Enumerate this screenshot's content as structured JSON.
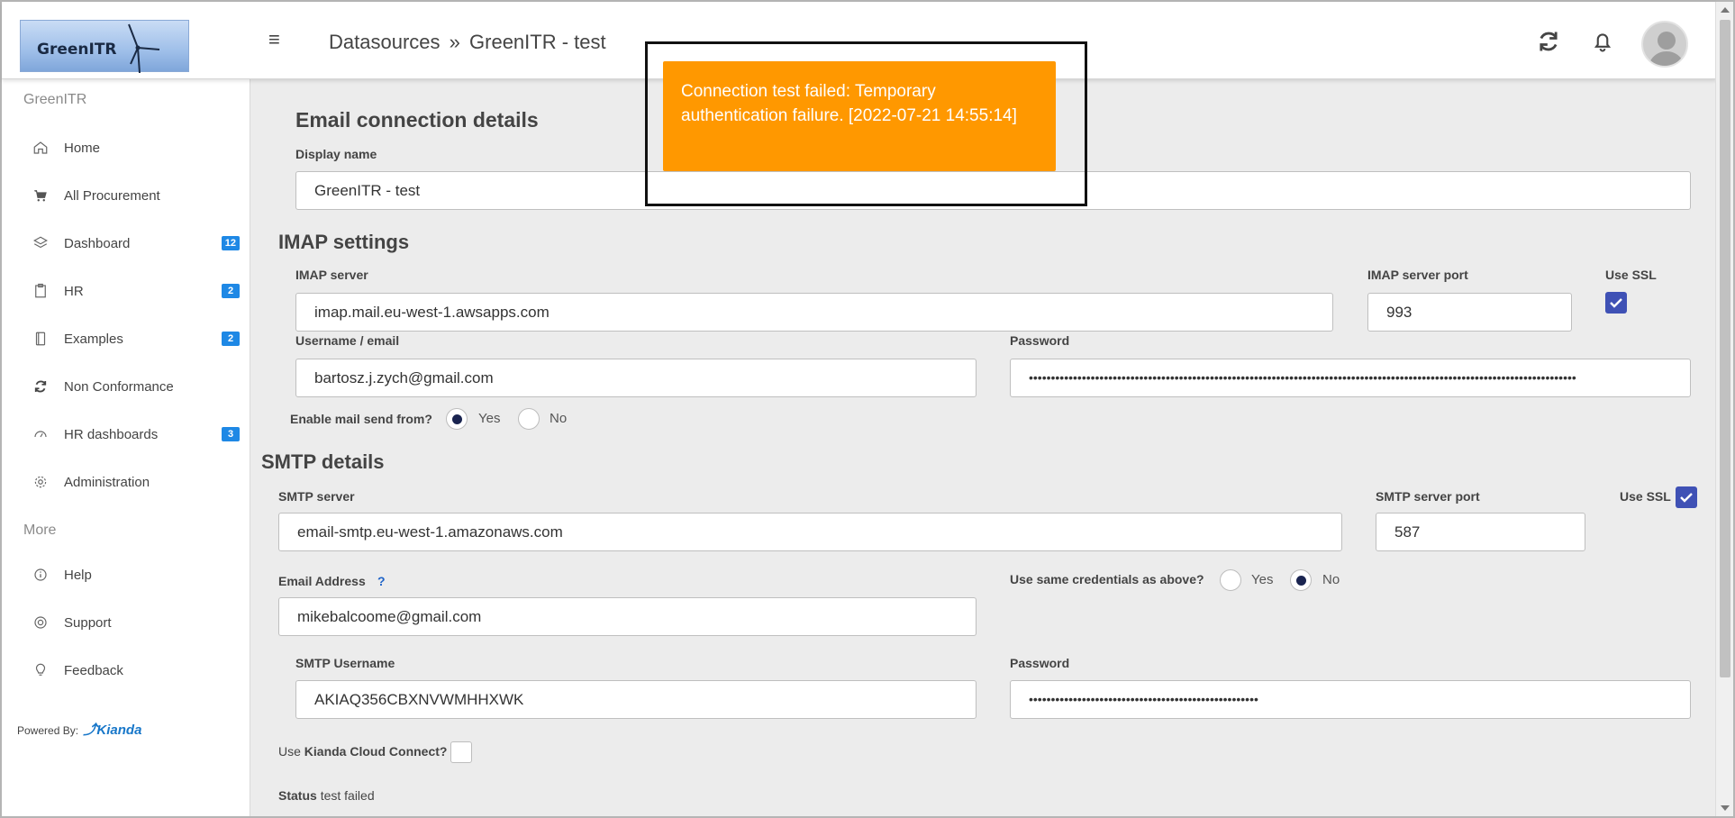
{
  "header": {
    "logo_text": "GreenITR",
    "breadcrumb_parent": "Datasources",
    "breadcrumb_sep": "»",
    "breadcrumb_current": "GreenITR - test"
  },
  "toast": {
    "message": "Connection test failed: Temporary authentication failure. [2022-07-21 14:55:14]"
  },
  "sidebar": {
    "app_heading": "GreenITR",
    "items": [
      {
        "label": "Home",
        "icon": "home-icon",
        "badge": ""
      },
      {
        "label": "All Procurement",
        "icon": "cart-icon",
        "badge": ""
      },
      {
        "label": "Dashboard",
        "icon": "layers-icon",
        "badge": "12"
      },
      {
        "label": "HR",
        "icon": "clipboard-icon",
        "badge": "2"
      },
      {
        "label": "Examples",
        "icon": "book-icon",
        "badge": "2"
      },
      {
        "label": "Non Conformance",
        "icon": "refresh-icon",
        "badge": ""
      },
      {
        "label": "HR dashboards",
        "icon": "gauge-icon",
        "badge": "3"
      },
      {
        "label": "Administration",
        "icon": "gear-icon",
        "badge": ""
      }
    ],
    "more_heading": "More",
    "more_items": [
      {
        "label": "Help",
        "icon": "info-icon"
      },
      {
        "label": "Support",
        "icon": "lifebuoy-icon"
      },
      {
        "label": "Feedback",
        "icon": "lightbulb-icon"
      }
    ],
    "powered_by": "Powered By:",
    "powered_brand": "Kianda"
  },
  "form": {
    "email_title": "Email connection details",
    "display_name_label": "Display name",
    "display_name_value": "GreenITR - test",
    "imap_title": "IMAP settings",
    "imap_server_label": "IMAP server",
    "imap_server_value": "imap.mail.eu-west-1.awsapps.com",
    "imap_port_label": "IMAP server port",
    "imap_port_value": "993",
    "imap_ssl_label": "Use SSL",
    "imap_ssl_checked": true,
    "username_label": "Username / email",
    "username_value": "bartosz.j.zych@gmail.com",
    "password_label": "Password",
    "password_value": "••••••••••••••••••••••••••••••••••••••••••••••••••••••••••••••••••••••••••••••••••••••••••••••••••••••••••••••••••••••••••••",
    "send_from_label": "Enable mail send from?",
    "send_from_yes": "Yes",
    "send_from_no": "No",
    "send_from_selected": "Yes",
    "smtp_title": "SMTP details",
    "smtp_server_label": "SMTP server",
    "smtp_server_value": "email-smtp.eu-west-1.amazonaws.com",
    "smtp_port_label": "SMTP server port",
    "smtp_port_value": "587",
    "smtp_ssl_label": "Use SSL",
    "smtp_ssl_checked": true,
    "email_address_label": "Email Address",
    "email_address_help": "?",
    "email_address_value": "mikebalcoome@gmail.com",
    "same_creds_label": "Use same credentials as above?",
    "same_creds_yes": "Yes",
    "same_creds_no": "No",
    "same_creds_selected": "No",
    "smtp_username_label": "SMTP Username",
    "smtp_username_value": "AKIAQ356CBXNVWMHHXWK",
    "smtp_password_label": "Password",
    "smtp_password_value": "••••••••••••••••••••••••••••••••••••••••••••••••••••",
    "cloud_connect_prefix": "Use",
    "cloud_connect_bold": "Kianda Cloud Connect?",
    "cloud_connect_checked": false,
    "status_label": "Status",
    "status_value": "test failed"
  },
  "colors": {
    "accent": "#3f51b5",
    "toast": "#ff9800",
    "badge": "#1e88e5"
  }
}
